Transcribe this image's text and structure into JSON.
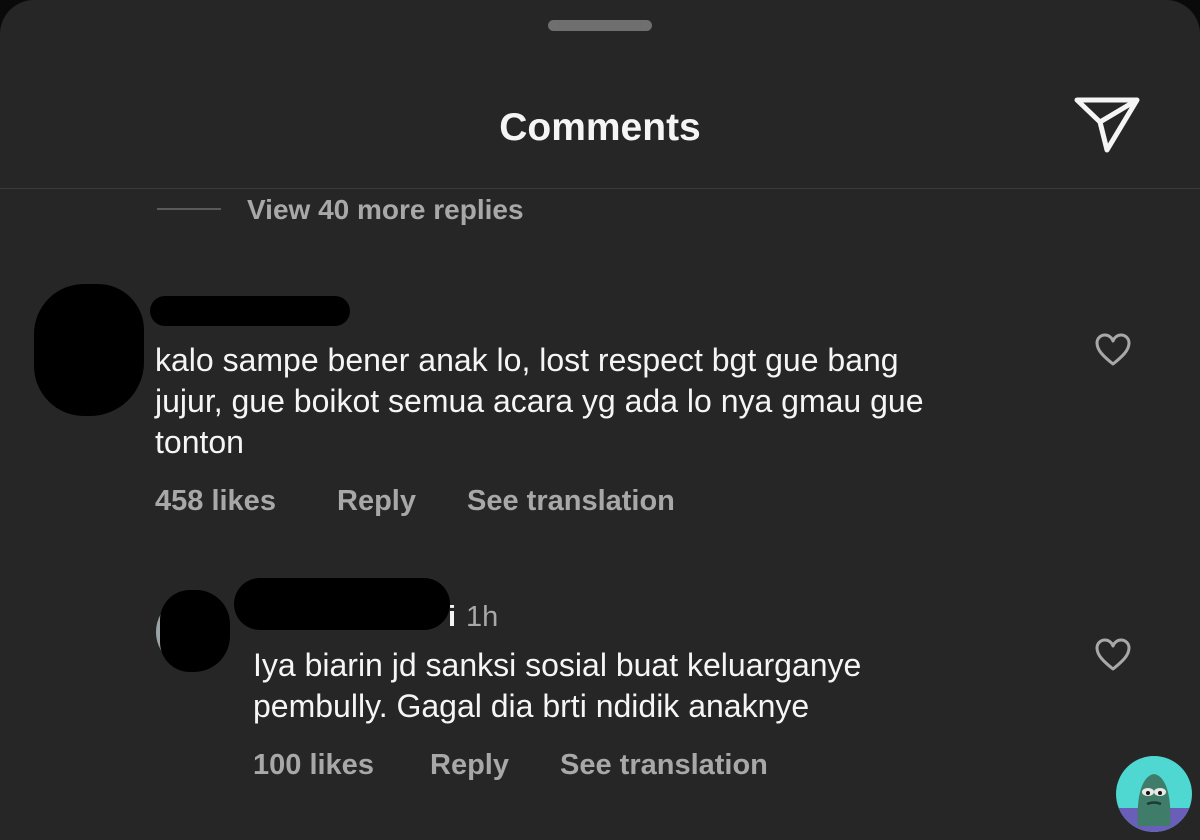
{
  "header": {
    "title": "Comments"
  },
  "thread": {
    "view_more_replies": "View 40 more replies"
  },
  "comments": [
    {
      "lines": [
        "kalo sampe bener anak lo, lost respect bgt gue bang",
        "jujur, gue boikot semua acara yg ada lo nya gmau gue",
        "tonton"
      ],
      "likes": "458 likes",
      "reply": "Reply",
      "translate": "See translation"
    },
    {
      "username_fragment": "i",
      "time": "1h",
      "lines": [
        "Iya biarin jd sanksi sosial buat keluarganye",
        "pembully. Gagal dia brti ndidik anaknye"
      ],
      "likes": "100 likes",
      "reply": "Reply",
      "translate": "See translation"
    }
  ],
  "icons": {
    "share": "paper-plane-icon",
    "like": "heart-outline-icon"
  },
  "colors": {
    "background": "#262626",
    "text_primary": "#f5f5f5",
    "text_secondary": "#a8a8a8",
    "watermark": "#4fd7d2"
  }
}
